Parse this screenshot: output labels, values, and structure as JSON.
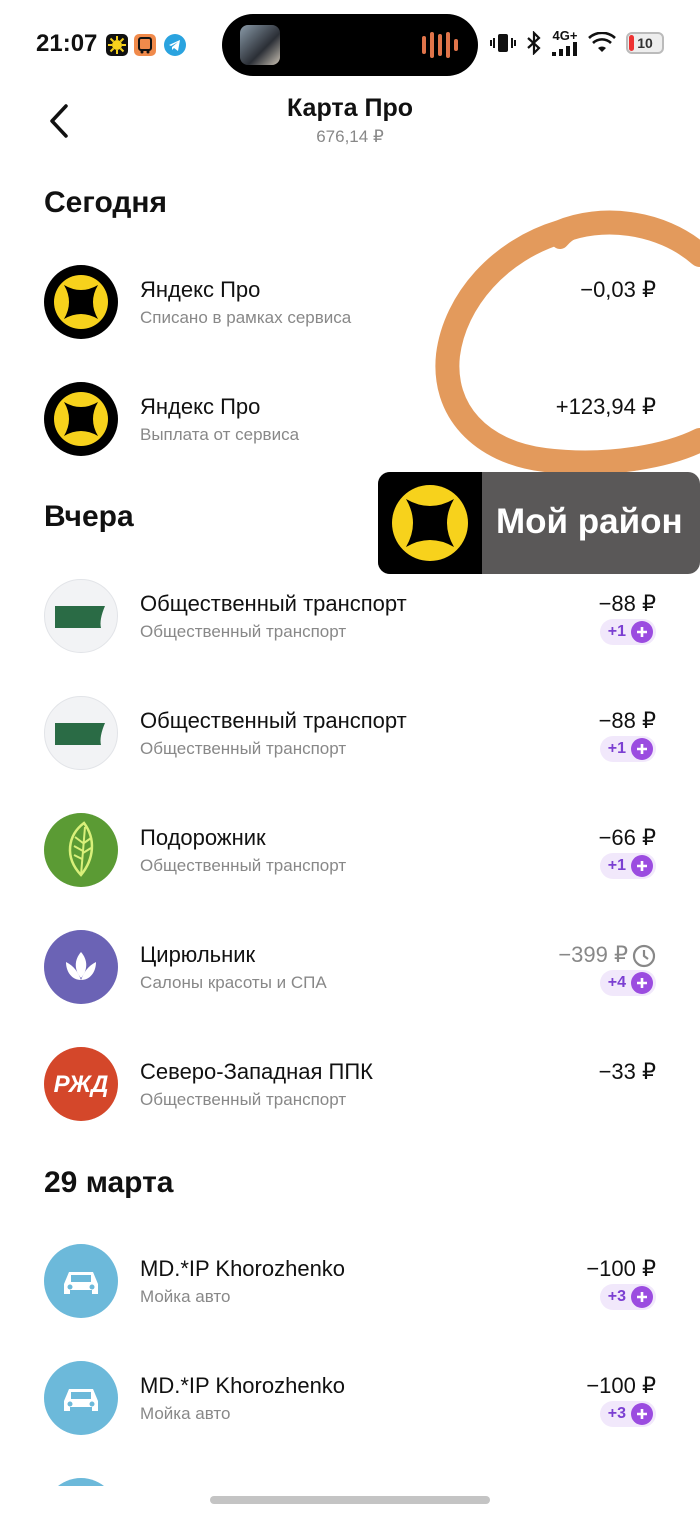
{
  "status": {
    "time": "21:07",
    "network": "4G+",
    "battery": "10"
  },
  "header": {
    "title": "Карта Про",
    "balance": "676,14 ₽"
  },
  "sections": [
    {
      "label": "Сегодня",
      "items": [
        {
          "name": "Яндекс Про",
          "category": "Списано в рамках сервиса",
          "amount": "−0,03 ₽",
          "icon": "yandex-pro-logo"
        },
        {
          "name": "Яндекс Про",
          "category": "Выплата от сервиса",
          "amount": "+123,94 ₽",
          "icon": "yandex-pro-logo"
        }
      ]
    },
    {
      "label": "Вчера",
      "items": [
        {
          "name": "Общественный транспорт",
          "category": "Общественный транспорт",
          "amount": "−88 ₽",
          "plus": "+1",
          "icon": "bus-icon"
        },
        {
          "name": "Общественный транспорт",
          "category": "Общественный транспорт",
          "amount": "−88 ₽",
          "plus": "+1",
          "icon": "bus-icon"
        },
        {
          "name": "Подорожник",
          "category": "Общественный транспорт",
          "amount": "−66 ₽",
          "plus": "+1",
          "icon": "leaf-icon"
        },
        {
          "name": "Цирюльник",
          "category": "Салоны красоты и СПА",
          "amount": "−399 ₽",
          "plus": "+4",
          "icon": "lotus-icon",
          "pending": true
        },
        {
          "name": "Северо-Западная ППК",
          "category": "Общественный транспорт",
          "amount": "−33 ₽",
          "icon": "rzd-icon"
        }
      ]
    },
    {
      "label": "29 марта",
      "items": [
        {
          "name": "MD.*IP Khorozhenko",
          "category": "Мойка авто",
          "amount": "−100 ₽",
          "plus": "+3",
          "icon": "car-icon"
        },
        {
          "name": "MD.*IP Khorozhenko",
          "category": "Мойка авто",
          "amount": "−100 ₽",
          "plus": "+3",
          "icon": "car-icon"
        }
      ]
    }
  ],
  "overlay_badge": {
    "label": "Мой район"
  },
  "colors": {
    "accent_plus": "#7b3fd2",
    "scribble": "#e39a5c",
    "yandex_yellow": "#f7d21c"
  }
}
